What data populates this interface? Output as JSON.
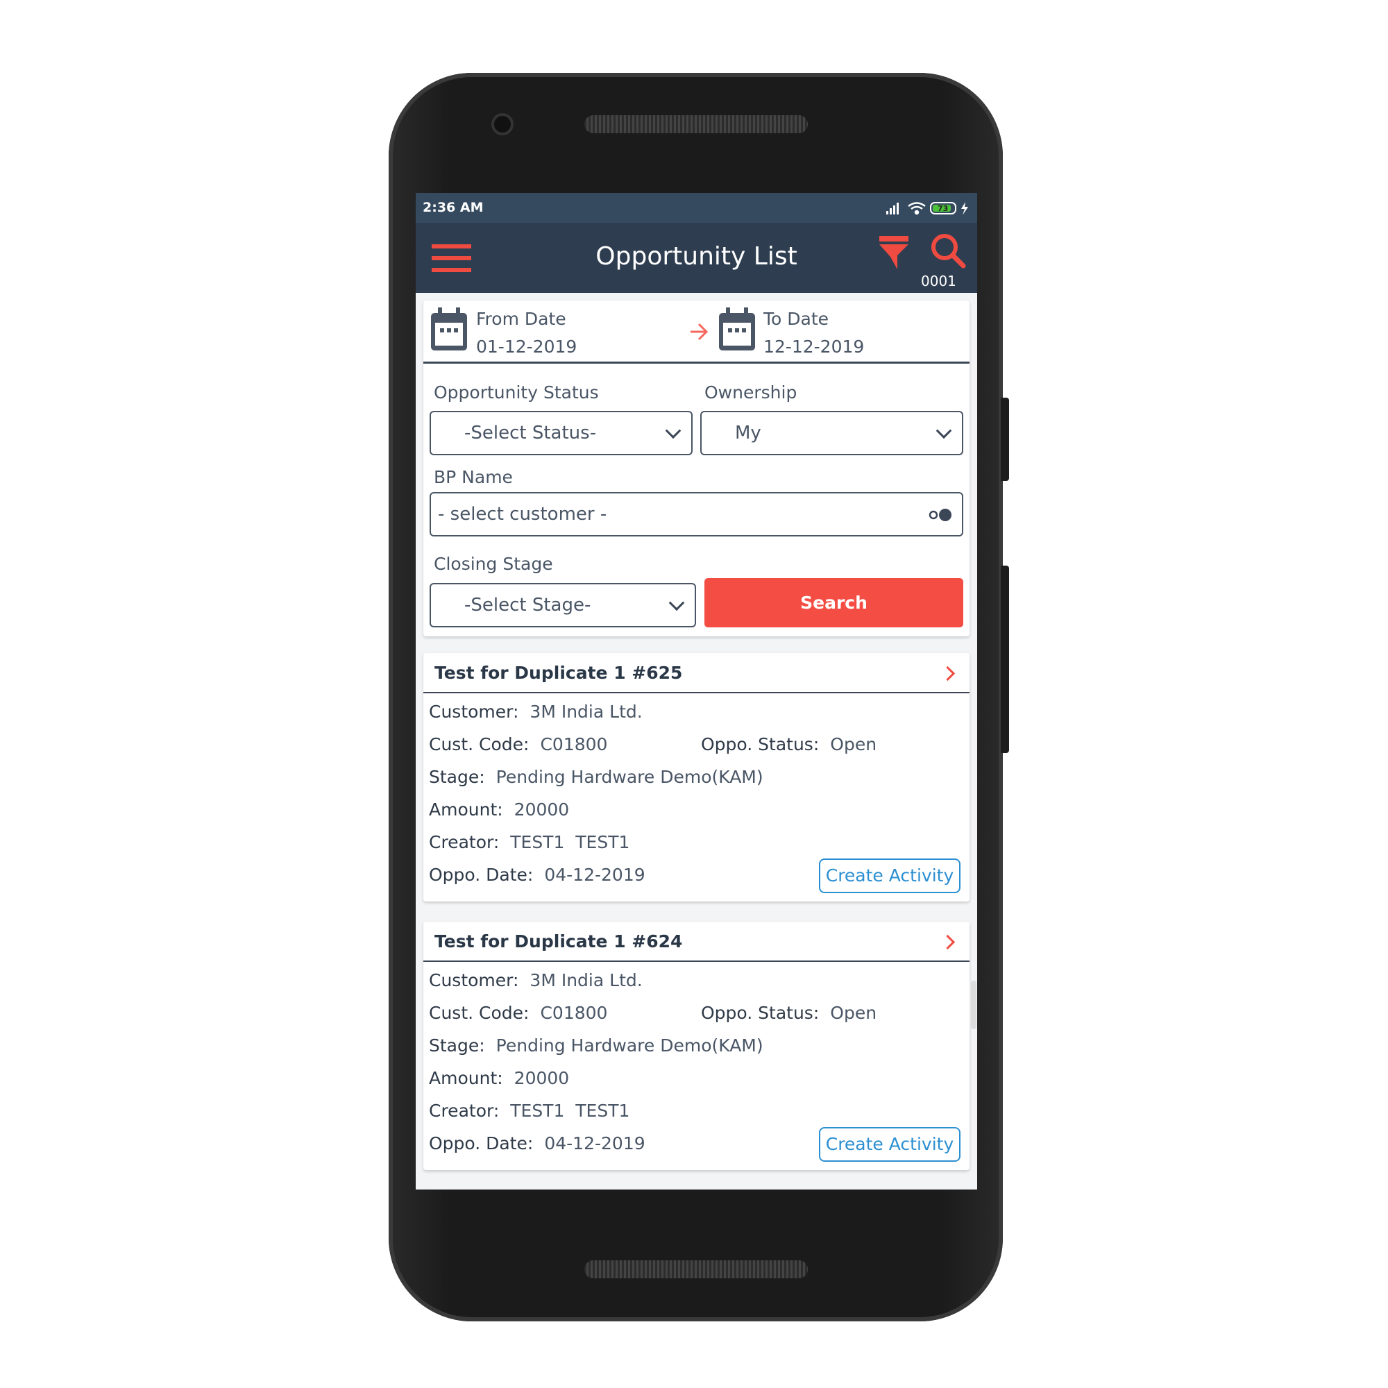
{
  "status_bar": {
    "time": "2:36 AM",
    "battery": "73"
  },
  "header": {
    "title": "Opportunity List",
    "counter": "0001"
  },
  "dates": {
    "from_label": "From Date",
    "from_value": "01-12-2019",
    "to_label": "To Date",
    "to_value": "12-12-2019"
  },
  "filters": {
    "status_label": "Opportunity Status",
    "status_value": "-Select Status-",
    "ownership_label": "Ownership",
    "ownership_value": "My",
    "bp_label": "BP Name",
    "bp_placeholder": "- select customer -",
    "stage_label": "Closing Stage",
    "stage_value": "-Select Stage-",
    "search_label": "Search"
  },
  "labels": {
    "customer": "Customer:",
    "cust_code": "Cust. Code:",
    "oppo_status": "Oppo. Status:",
    "stage": "Stage:",
    "amount": "Amount:",
    "creator": "Creator:",
    "oppo_date": "Oppo. Date:",
    "create_activity": "Create Activity"
  },
  "opportunities": [
    {
      "title": "Test for Duplicate 1 #625",
      "customer": "3M India Ltd.",
      "cust_code": "C01800",
      "oppo_status": "Open",
      "stage": "Pending Hardware Demo(KAM)",
      "amount": "20000",
      "creator": "TEST1  TEST1",
      "oppo_date": "04-12-2019"
    },
    {
      "title": "Test for Duplicate 1 #624",
      "customer": "3M India Ltd.",
      "cust_code": "C01800",
      "oppo_status": "Open",
      "stage": "Pending Hardware Demo(KAM)",
      "amount": "20000",
      "creator": "TEST1  TEST1",
      "oppo_date": "04-12-2019"
    }
  ],
  "colors": {
    "accent": "#f04b41",
    "header": "#2e3e50",
    "statusbar": "#354a5f",
    "link": "#2c8fd1"
  }
}
